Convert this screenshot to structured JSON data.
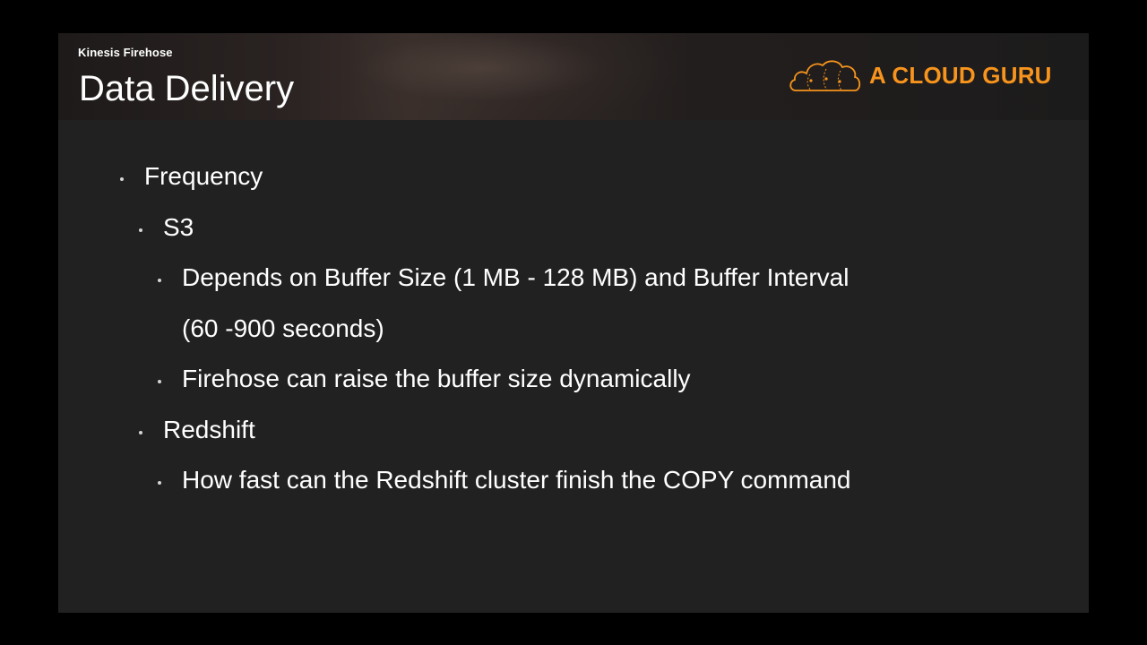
{
  "header": {
    "subtitle": "Kinesis Firehose",
    "title": "Data Delivery",
    "brand_name": "A CLOUD GURU",
    "brand_color": "#f7941d",
    "brand_icon": "cloud-icon"
  },
  "content": {
    "bullets": [
      {
        "level": 1,
        "text": "Frequency"
      },
      {
        "level": 2,
        "text": "S3"
      },
      {
        "level": 3,
        "text": "Depends on Buffer Size (1 MB - 128 MB) and Buffer Interval"
      },
      {
        "level": 3,
        "text": "(60 -900 seconds)",
        "continuation": true
      },
      {
        "level": 3,
        "text": "Firehose can raise the buffer size dynamically"
      },
      {
        "level": 2,
        "text": "Redshift"
      },
      {
        "level": 3,
        "text": "How fast can the Redshift cluster finish the COPY command"
      }
    ]
  },
  "colors": {
    "page_background": "#000000",
    "slide_background": "#212121",
    "text": "#ffffff"
  }
}
